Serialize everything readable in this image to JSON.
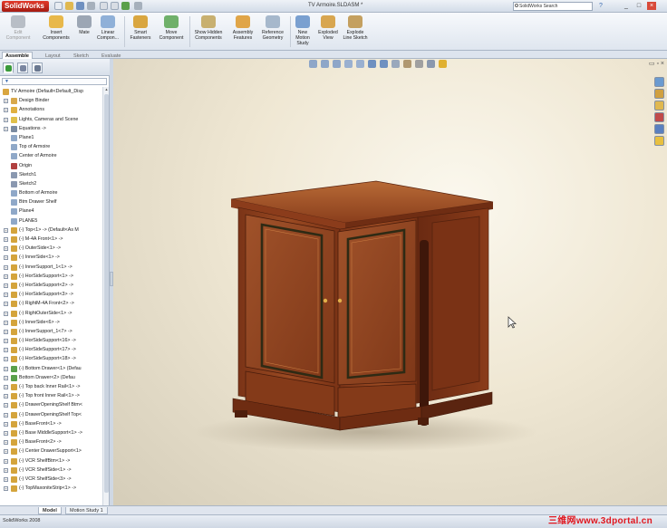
{
  "app": {
    "logo": "SolidWorks",
    "document_title": "TV Armoire.SLDASM *",
    "search_placeholder": "SolidWorks Search",
    "window_buttons": [
      "_",
      "□",
      "×"
    ]
  },
  "ribbon": {
    "buttons": [
      {
        "id": "edit-component",
        "label": "Edit Component",
        "icon": "edit-component-icon",
        "color": "#9aa0a8",
        "dim": true
      },
      {
        "id": "insert-components",
        "label": "Insert Components",
        "icon": "insert-components-icon",
        "color": "#e8b84a"
      },
      {
        "id": "mate",
        "label": "Mate",
        "icon": "mate-icon",
        "color": "#9ca6b4"
      },
      {
        "id": "linear-component",
        "label": "Linear Compon...",
        "icon": "linear-pattern-icon",
        "color": "#8fb0d8"
      },
      {
        "id": "smart-fasteners",
        "label": "Smart Fasteners",
        "icon": "smart-fasteners-icon",
        "color": "#d9a640"
      },
      {
        "id": "move-component",
        "label": "Move Component",
        "icon": "move-component-icon",
        "color": "#6fb06a"
      },
      {
        "id": "show-hidden",
        "label": "Show Hidden Components",
        "icon": "show-hidden-icon",
        "color": "#c8b070"
      },
      {
        "id": "assembly-features",
        "label": "Assembly Features",
        "icon": "assembly-features-icon",
        "color": "#e0a548"
      },
      {
        "id": "reference-geometry",
        "label": "Reference Geometry",
        "icon": "reference-geometry-icon",
        "color": "#a6b8cc"
      },
      {
        "id": "new-motion-study",
        "label": "New Motion Study",
        "icon": "motion-study-icon",
        "color": "#7aa0d0"
      },
      {
        "id": "exploded-view",
        "label": "Exploded View",
        "icon": "exploded-view-icon",
        "color": "#d8a650"
      },
      {
        "id": "explode-line-sketch",
        "label": "Explode Line Sketch",
        "icon": "explode-line-sketch-icon",
        "color": "#c4a060"
      }
    ]
  },
  "command_tabs": [
    {
      "label": "Assemble",
      "active": true
    },
    {
      "label": "Layout",
      "active": false
    },
    {
      "label": "Sketch",
      "active": false
    },
    {
      "label": "Evaluate",
      "active": false
    }
  ],
  "feature_manager": {
    "tabs": [
      {
        "icon": "feature-manager-icon",
        "color": "#3a9a3a",
        "active": true
      },
      {
        "icon": "property-manager-icon",
        "color": "#7a86a0",
        "active": false
      },
      {
        "icon": "configuration-manager-icon",
        "color": "#6a7890",
        "active": false
      }
    ],
    "filter_icon": "filter-icon",
    "tree": [
      {
        "label": "TV Armoire  (Default<Default_Disp",
        "level": 0,
        "icon": "assembly-icon",
        "color": "#d9a640",
        "exp": ""
      },
      {
        "label": "Design Binder",
        "level": 1,
        "icon": "design-binder-icon",
        "color": "#d8a84a",
        "exp": "+"
      },
      {
        "label": "Annotations",
        "level": 1,
        "icon": "annotations-icon",
        "color": "#e0b040",
        "exp": "+"
      },
      {
        "label": "Lights, Cameras and Scene",
        "level": 1,
        "icon": "lights-icon",
        "color": "#e0c04a",
        "exp": "+"
      },
      {
        "label": "Equations ->",
        "level": 1,
        "icon": "equations-icon",
        "color": "#7a8aa0",
        "exp": "+"
      },
      {
        "label": "Plane1",
        "level": 1,
        "icon": "plane-icon",
        "color": "#8fa8c8",
        "exp": ""
      },
      {
        "label": "Top of Armoire",
        "level": 1,
        "icon": "plane-icon",
        "color": "#8fa8c8",
        "exp": ""
      },
      {
        "label": "Center of Armoire",
        "level": 1,
        "icon": "plane-icon",
        "color": "#8fa8c8",
        "exp": ""
      },
      {
        "label": "Origin",
        "level": 1,
        "icon": "origin-icon",
        "color": "#b04040",
        "exp": ""
      },
      {
        "label": "Sketch1",
        "level": 1,
        "icon": "sketch-icon",
        "color": "#8a98b0",
        "exp": ""
      },
      {
        "label": "Sketch2",
        "level": 1,
        "icon": "sketch-icon",
        "color": "#8a98b0",
        "exp": ""
      },
      {
        "label": "Bottom of Armoire",
        "level": 1,
        "icon": "plane-icon",
        "color": "#8fa8c8",
        "exp": ""
      },
      {
        "label": "Btm Drawer Shelf",
        "level": 1,
        "icon": "plane-icon",
        "color": "#8fa8c8",
        "exp": ""
      },
      {
        "label": "Plane4",
        "level": 1,
        "icon": "plane-icon",
        "color": "#8fa8c8",
        "exp": ""
      },
      {
        "label": "PLANE5",
        "level": 1,
        "icon": "plane-icon",
        "color": "#8fa8c8",
        "exp": ""
      },
      {
        "label": "(-) Top<1> -> (Default<As M",
        "level": 1,
        "icon": "part-icon",
        "color": "#d4a43c",
        "exp": "+"
      },
      {
        "label": "(-) M-4A Front<1> ->",
        "level": 1,
        "icon": "part-icon",
        "color": "#d4a43c",
        "exp": "+"
      },
      {
        "label": "(-) OuterSide<1> ->",
        "level": 1,
        "icon": "part-icon",
        "color": "#d4a43c",
        "exp": "+"
      },
      {
        "label": "(-) InnerSide<1> ->",
        "level": 1,
        "icon": "part-icon",
        "color": "#d4a43c",
        "exp": "+"
      },
      {
        "label": "(-) InnerSupport_1<1> ->",
        "level": 1,
        "icon": "part-icon",
        "color": "#d4a43c",
        "exp": "+"
      },
      {
        "label": "(-) HorSideSupport<1> ->",
        "level": 1,
        "icon": "part-icon",
        "color": "#d4a43c",
        "exp": "+"
      },
      {
        "label": "(-) HorSideSupport<2> ->",
        "level": 1,
        "icon": "part-icon",
        "color": "#d4a43c",
        "exp": "+"
      },
      {
        "label": "(-) HorSideSupport<3> ->",
        "level": 1,
        "icon": "part-icon",
        "color": "#d4a43c",
        "exp": "+"
      },
      {
        "label": "(-) RightM-4A Front<2> ->",
        "level": 1,
        "icon": "part-icon",
        "color": "#d4a43c",
        "exp": "+"
      },
      {
        "label": "(-) RightOuterSide<1> ->",
        "level": 1,
        "icon": "part-icon",
        "color": "#d4a43c",
        "exp": "+"
      },
      {
        "label": "(-) InnerSide<6> ->",
        "level": 1,
        "icon": "part-icon",
        "color": "#d4a43c",
        "exp": "+"
      },
      {
        "label": "(-) InnerSupport_1<7> ->",
        "level": 1,
        "icon": "part-icon",
        "color": "#d4a43c",
        "exp": "+"
      },
      {
        "label": "(-) HorSideSupport<16> ->",
        "level": 1,
        "icon": "part-icon",
        "color": "#d4a43c",
        "exp": "+"
      },
      {
        "label": "(-) HorSideSupport<17> ->",
        "level": 1,
        "icon": "part-icon",
        "color": "#d4a43c",
        "exp": "+"
      },
      {
        "label": "(-) HorSideSupport<18> ->",
        "level": 1,
        "icon": "part-icon",
        "color": "#d4a43c",
        "exp": "+"
      },
      {
        "label": "(-) Bottom Drawer<1> (Defau",
        "level": 1,
        "icon": "subassembly-icon",
        "color": "#5aa04a",
        "exp": "+"
      },
      {
        "label": "Bottom Drawer<2> (Defau",
        "level": 1,
        "icon": "subassembly-icon",
        "color": "#5aa04a",
        "exp": "+"
      },
      {
        "label": "(-) Top back Inner Rail<1> ->",
        "level": 1,
        "icon": "part-icon",
        "color": "#d4a43c",
        "exp": "+"
      },
      {
        "label": "(-) Top front Inner Rail<1> ->",
        "level": 1,
        "icon": "part-icon",
        "color": "#d4a43c",
        "exp": "+"
      },
      {
        "label": "(-) DrawerOpeningShelf Btm<",
        "level": 1,
        "icon": "part-icon",
        "color": "#d4a43c",
        "exp": "+"
      },
      {
        "label": "(-) DrawerOpeningShelf Top<",
        "level": 1,
        "icon": "part-icon",
        "color": "#d4a43c",
        "exp": "+"
      },
      {
        "label": "(-) BaseFront<1> ->",
        "level": 1,
        "icon": "part-icon",
        "color": "#d4a43c",
        "exp": "+"
      },
      {
        "label": "(-) Base MiddleSupport<1> ->",
        "level": 1,
        "icon": "part-icon",
        "color": "#d4a43c",
        "exp": "+"
      },
      {
        "label": "(-) BaseFront<2> ->",
        "level": 1,
        "icon": "part-icon",
        "color": "#d4a43c",
        "exp": "+"
      },
      {
        "label": "(-) Center DrawerSupport<1>",
        "level": 1,
        "icon": "part-icon",
        "color": "#d4a43c",
        "exp": "+"
      },
      {
        "label": "(-) VCR ShelfBtm<1> ->",
        "level": 1,
        "icon": "part-icon",
        "color": "#d4a43c",
        "exp": "+"
      },
      {
        "label": "(-) VCR ShelfSide<1> ->",
        "level": 1,
        "icon": "part-icon",
        "color": "#d4a43c",
        "exp": "+"
      },
      {
        "label": "(-) VCR ShelfSide<3> ->",
        "level": 1,
        "icon": "part-icon",
        "color": "#d4a43c",
        "exp": "+"
      },
      {
        "label": "(-) TopMaxoniteStrip<1> ->",
        "level": 1,
        "icon": "part-icon",
        "color": "#d4a43c",
        "exp": "+"
      }
    ]
  },
  "heads_up_toolbar": [
    {
      "icon": "zoom-to-fit-icon",
      "color": "#8ea6c8"
    },
    {
      "icon": "zoom-to-area-icon",
      "color": "#8ea6c8"
    },
    {
      "icon": "previous-view-icon",
      "color": "#8ea6c8"
    },
    {
      "icon": "section-view-icon",
      "color": "#9ab0d0"
    },
    {
      "icon": "dynamic-annotation-icon",
      "color": "#9ab0d0"
    },
    {
      "icon": "view-orientation-icon",
      "color": "#6f90c0"
    },
    {
      "icon": "display-style-icon",
      "color": "#6f90c0"
    },
    {
      "icon": "hide-show-items-icon",
      "color": "#9aa8bc"
    },
    {
      "icon": "edit-appearance-icon",
      "color": "#b09870"
    },
    {
      "icon": "apply-scene-icon",
      "color": "#a0a0a0"
    },
    {
      "icon": "view-settings-icon",
      "color": "#8a98ae"
    },
    {
      "icon": "realview-graphics-icon",
      "color": "#e0b030"
    }
  ],
  "task_pane": [
    {
      "icon": "solidworks-resources-icon",
      "color": "#6a9ad0"
    },
    {
      "icon": "design-library-icon",
      "color": "#d0a040"
    },
    {
      "icon": "file-explorer-icon",
      "color": "#e0b850"
    },
    {
      "icon": "search-results-icon",
      "color": "#c04a4a"
    },
    {
      "icon": "view-palette-icon",
      "color": "#5a80c0"
    },
    {
      "icon": "appearances-scenes-icon",
      "color": "#e8c040"
    }
  ],
  "model_tabs": [
    {
      "label": "Model",
      "active": true
    },
    {
      "label": "Motion Study 1",
      "active": false
    }
  ],
  "status": {
    "left_text": "SolidWorks 2008",
    "watermark": "三维网www.3dportal.cn"
  },
  "colors": {
    "wood_dark": "#5a2410",
    "wood_mid": "#8a3d1a",
    "wood_light": "#b2602e",
    "inlay": "#2e2a14"
  }
}
